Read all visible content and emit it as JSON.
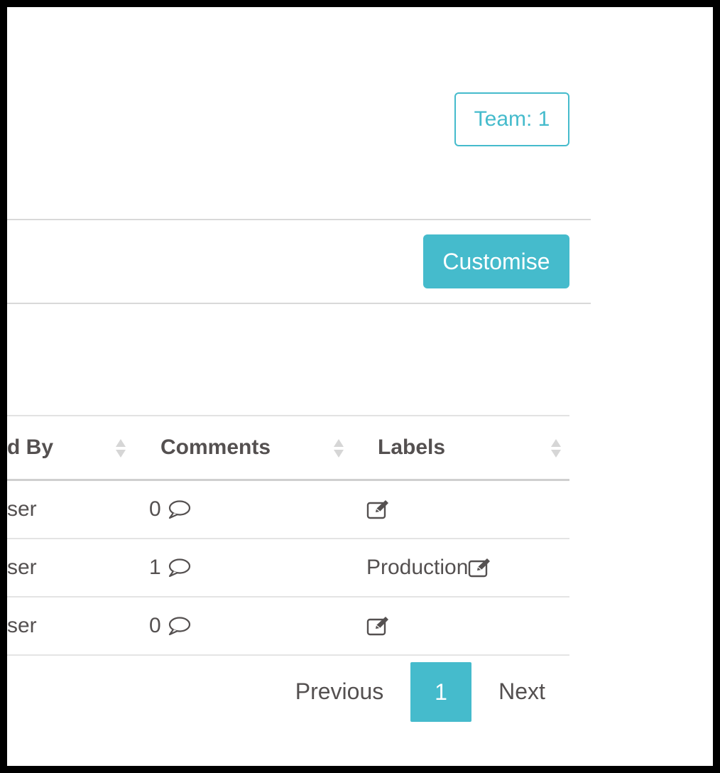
{
  "header": {
    "team_button_label": "Team: 1",
    "customise_button_label": "Customise"
  },
  "table": {
    "columns": [
      {
        "label": "d By"
      },
      {
        "label": "Comments"
      },
      {
        "label": "Labels"
      }
    ],
    "rows": [
      {
        "by": "ser",
        "comments": "0",
        "label": ""
      },
      {
        "by": "ser",
        "comments": "1",
        "label": "Production"
      },
      {
        "by": "ser",
        "comments": "0",
        "label": ""
      }
    ]
  },
  "pagination": {
    "previous_label": "Previous",
    "current_page": "1",
    "next_label": "Next"
  },
  "icons": {
    "sort": "sort-icon",
    "comment": "speech-bubble-icon",
    "edit": "edit-icon"
  },
  "colors": {
    "accent": "#45bbcc",
    "text": "#545050",
    "divider": "#d9d9d9"
  }
}
